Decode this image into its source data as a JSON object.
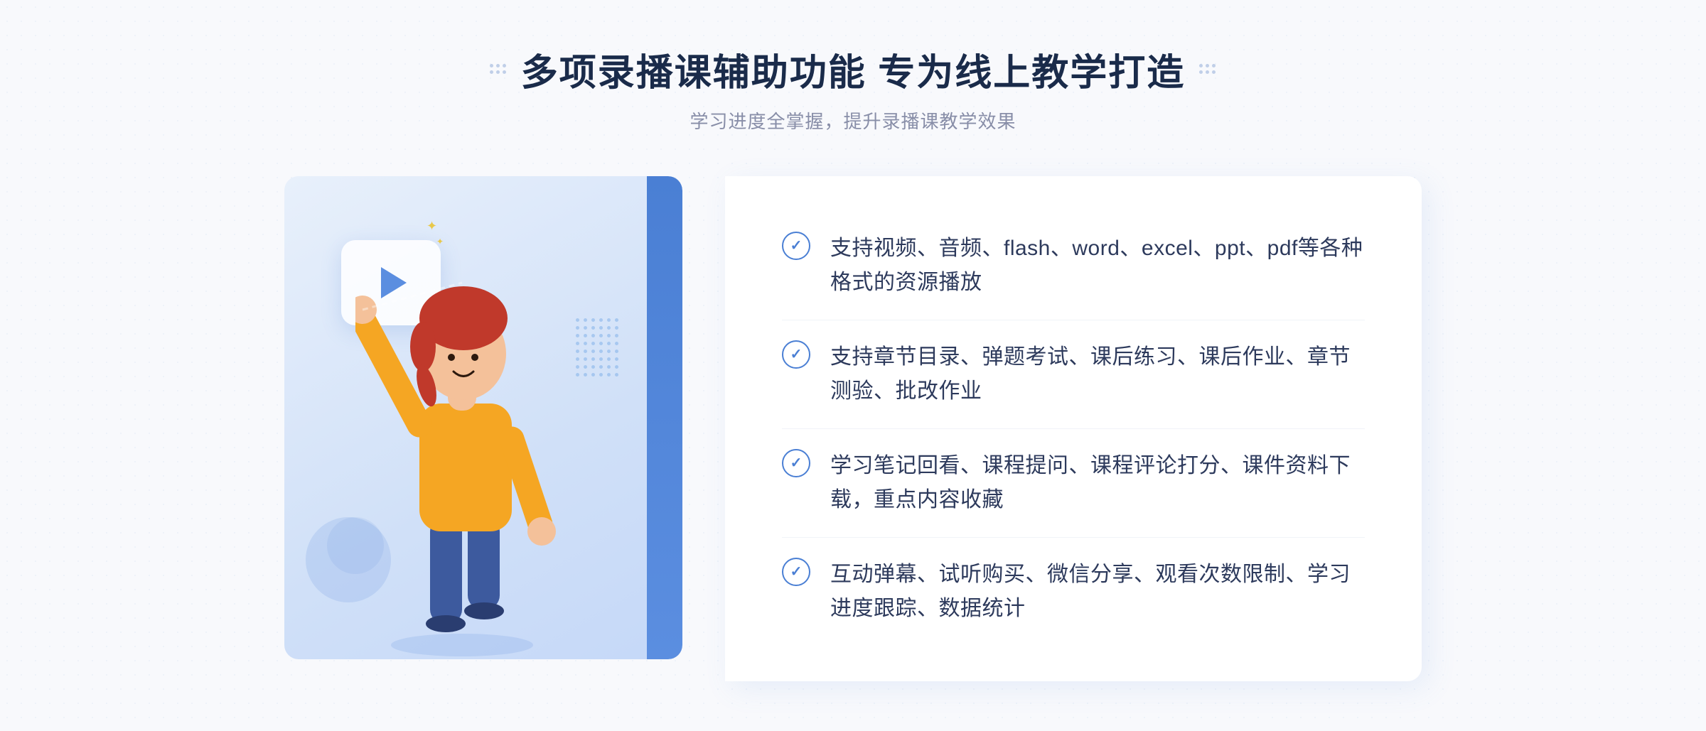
{
  "page": {
    "background": "#f8f9fc"
  },
  "header": {
    "title": "多项录播课辅助功能 专为线上教学打造",
    "subtitle": "学习进度全掌握，提升录播课教学效果"
  },
  "features": [
    {
      "id": 1,
      "text": "支持视频、音频、flash、word、excel、ppt、pdf等各种格式的资源播放"
    },
    {
      "id": 2,
      "text": "支持章节目录、弹题考试、课后练习、课后作业、章节测验、批改作业"
    },
    {
      "id": 3,
      "text": "学习笔记回看、课程提问、课程评论打分、课件资料下载，重点内容收藏"
    },
    {
      "id": 4,
      "text": "互动弹幕、试听购买、微信分享、观看次数限制、学习进度跟踪、数据统计"
    }
  ],
  "illustration": {
    "playButton": "▶",
    "chevronLeft": "《"
  }
}
